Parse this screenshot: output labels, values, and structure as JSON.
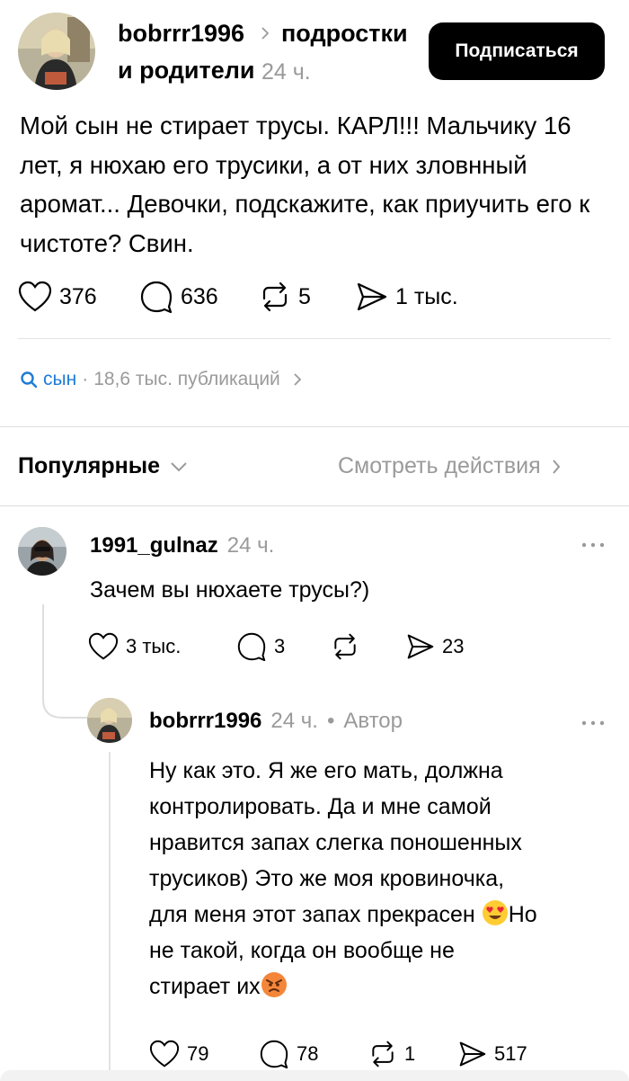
{
  "post": {
    "author": "bobrrr1996",
    "community": "подростки",
    "community_line2": "и родители",
    "time": "24 ч.",
    "follow_label": "Подписаться",
    "text": "Мой сын не стирает трусы. КАРЛ!!! Мальчику 16 лет, я нюхаю его трусики, а от них зловнный аромат... Девочки, подскажите, как приучить его к чистоте? Свин.",
    "likes": "376",
    "comments": "636",
    "reposts": "5",
    "shares": "1 тыс."
  },
  "tag": {
    "name": "сын",
    "count": "18,6 тыс. публикаций"
  },
  "sort": {
    "label": "Популярные",
    "view_activity": "Смотреть действия"
  },
  "comments": [
    {
      "author": "1991_gulnaz",
      "time": "24 ч.",
      "text": "Зачем вы нюхаете трусы?)",
      "likes": "3 тыс.",
      "comments": "3",
      "reposts": "",
      "shares": "23"
    },
    {
      "author": "bobrrr1996",
      "time": "24 ч.",
      "author_badge": "Автор",
      "text_lines": [
        "Ну как это. Я же его мать, должна",
        "контролировать. Да и мне самой",
        "нравится запах слегка поношенных",
        "трусиков) Это же моя кровиночка,",
        "для меня этот запах прекрасен",
        "не такой, когда он вообще не",
        "стирает их"
      ],
      "line5_suffix": "Но",
      "likes": "79",
      "comments": "78",
      "reposts": "1",
      "shares": "517"
    }
  ],
  "colors": {
    "accent_link": "#1f7bd6",
    "muted_text": "#9a9a9a",
    "button_bg": "#000000"
  },
  "icons": [
    "heart-icon",
    "comment-icon",
    "repost-icon",
    "share-icon",
    "search-icon",
    "chevron-right-icon",
    "chevron-down-icon",
    "more-icon",
    "heart-eyes-emoji",
    "angry-emoji"
  ]
}
